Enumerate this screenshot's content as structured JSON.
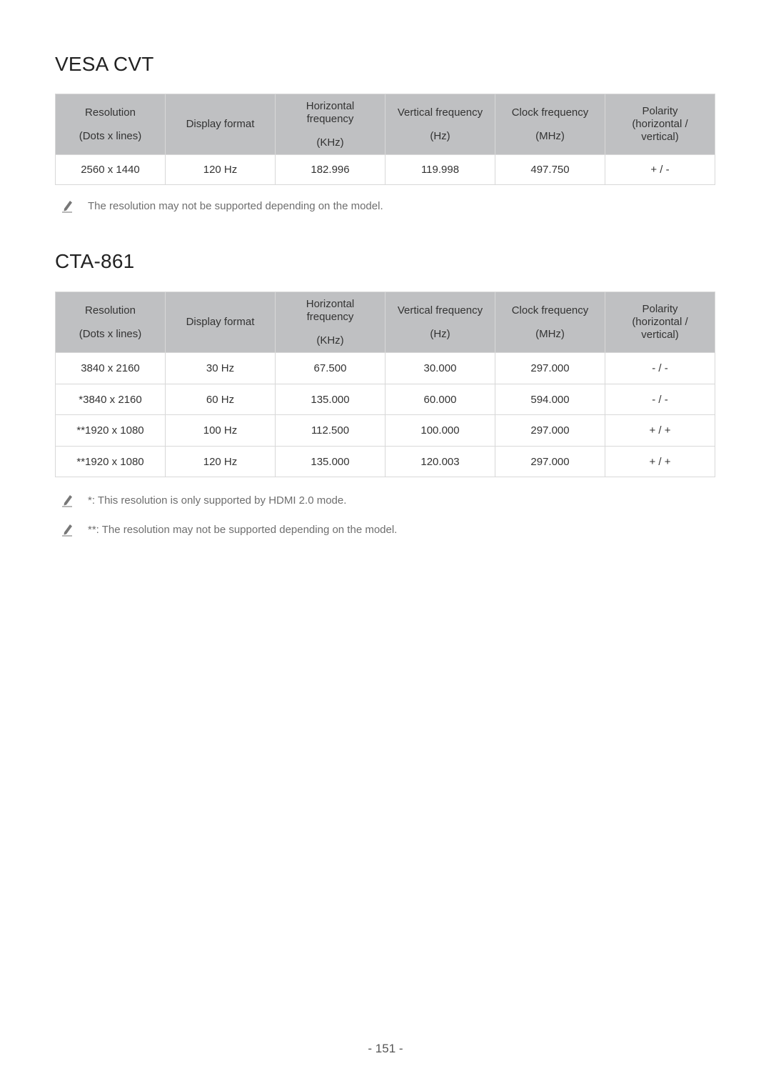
{
  "sections": [
    {
      "title": "VESA CVT",
      "headers": [
        {
          "lines": [
            "Resolution",
            "(Dots x lines)"
          ]
        },
        {
          "lines": [
            "Display format"
          ]
        },
        {
          "lines": [
            "Horizontal",
            "frequency",
            "(KHz)"
          ]
        },
        {
          "lines": [
            "Vertical frequency",
            "(Hz)"
          ]
        },
        {
          "lines": [
            "Clock frequency",
            "(MHz)"
          ]
        },
        {
          "lines": [
            "Polarity",
            "(horizontal /",
            "vertical)"
          ]
        }
      ],
      "rows": [
        [
          "2560 x 1440",
          "120 Hz",
          "182.996",
          "119.998",
          "497.750",
          "+ / -"
        ]
      ],
      "notes": [
        "The resolution may not be supported depending on the model."
      ]
    },
    {
      "title": "CTA-861",
      "headers": [
        {
          "lines": [
            "Resolution",
            "(Dots x lines)"
          ]
        },
        {
          "lines": [
            "Display format"
          ]
        },
        {
          "lines": [
            "Horizontal",
            "frequency",
            "(KHz)"
          ]
        },
        {
          "lines": [
            "Vertical frequency",
            "(Hz)"
          ]
        },
        {
          "lines": [
            "Clock frequency",
            "(MHz)"
          ]
        },
        {
          "lines": [
            "Polarity",
            "(horizontal /",
            "vertical)"
          ]
        }
      ],
      "rows": [
        [
          "3840 x 2160",
          "30 Hz",
          "67.500",
          "30.000",
          "297.000",
          "- / -"
        ],
        [
          "*3840 x 2160",
          "60 Hz",
          "135.000",
          "60.000",
          "594.000",
          "- / -"
        ],
        [
          "**1920 x 1080",
          "100 Hz",
          "112.500",
          "100.000",
          "297.000",
          "+ / +"
        ],
        [
          "**1920 x 1080",
          "120 Hz",
          "135.000",
          "120.003",
          "297.000",
          "+ / +"
        ]
      ],
      "notes": [
        "*: This resolution is only supported by HDMI 2.0 mode.",
        "**: The resolution may not be supported depending on the model."
      ]
    }
  ],
  "note_icon": "pencil-icon",
  "page_number": "- 151 -"
}
